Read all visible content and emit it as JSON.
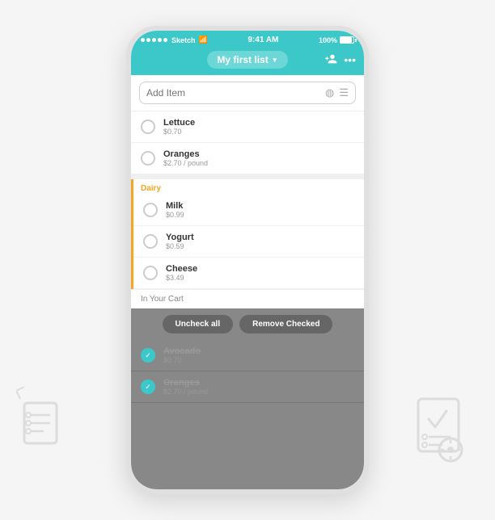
{
  "status_bar": {
    "carrier": "Sketch",
    "wifi": "wifi",
    "time": "9:41 AM",
    "battery": "100%"
  },
  "header": {
    "list_name": "My first list",
    "add_person_icon": "add-person",
    "more_icon": "more"
  },
  "add_item": {
    "placeholder": "Add Item",
    "history_icon": "history",
    "barcode_icon": "barcode"
  },
  "sections": [
    {
      "name": "produce",
      "label": null,
      "items": [
        {
          "name": "Lettuce",
          "price": "$0.70",
          "checked": false
        },
        {
          "name": "Oranges",
          "price": "$2.70 / pound",
          "checked": false
        }
      ]
    },
    {
      "name": "dairy",
      "label": "Dairy",
      "items": [
        {
          "name": "Milk",
          "price": "$0.99",
          "checked": false
        },
        {
          "name": "Yogurt",
          "price": "$0.59",
          "checked": false
        },
        {
          "name": "Cheese",
          "price": "$3.49",
          "checked": false
        }
      ]
    }
  ],
  "cart": {
    "header": "In Your Cart",
    "uncheck_all_label": "Uncheck all",
    "remove_checked_label": "Remove Checked",
    "items": [
      {
        "name": "Avocado",
        "price": "$0.70",
        "checked": true,
        "strikethrough": true
      },
      {
        "name": "Oranges",
        "price": "$2.70 / pound",
        "checked": true,
        "strikethrough": true
      }
    ]
  }
}
